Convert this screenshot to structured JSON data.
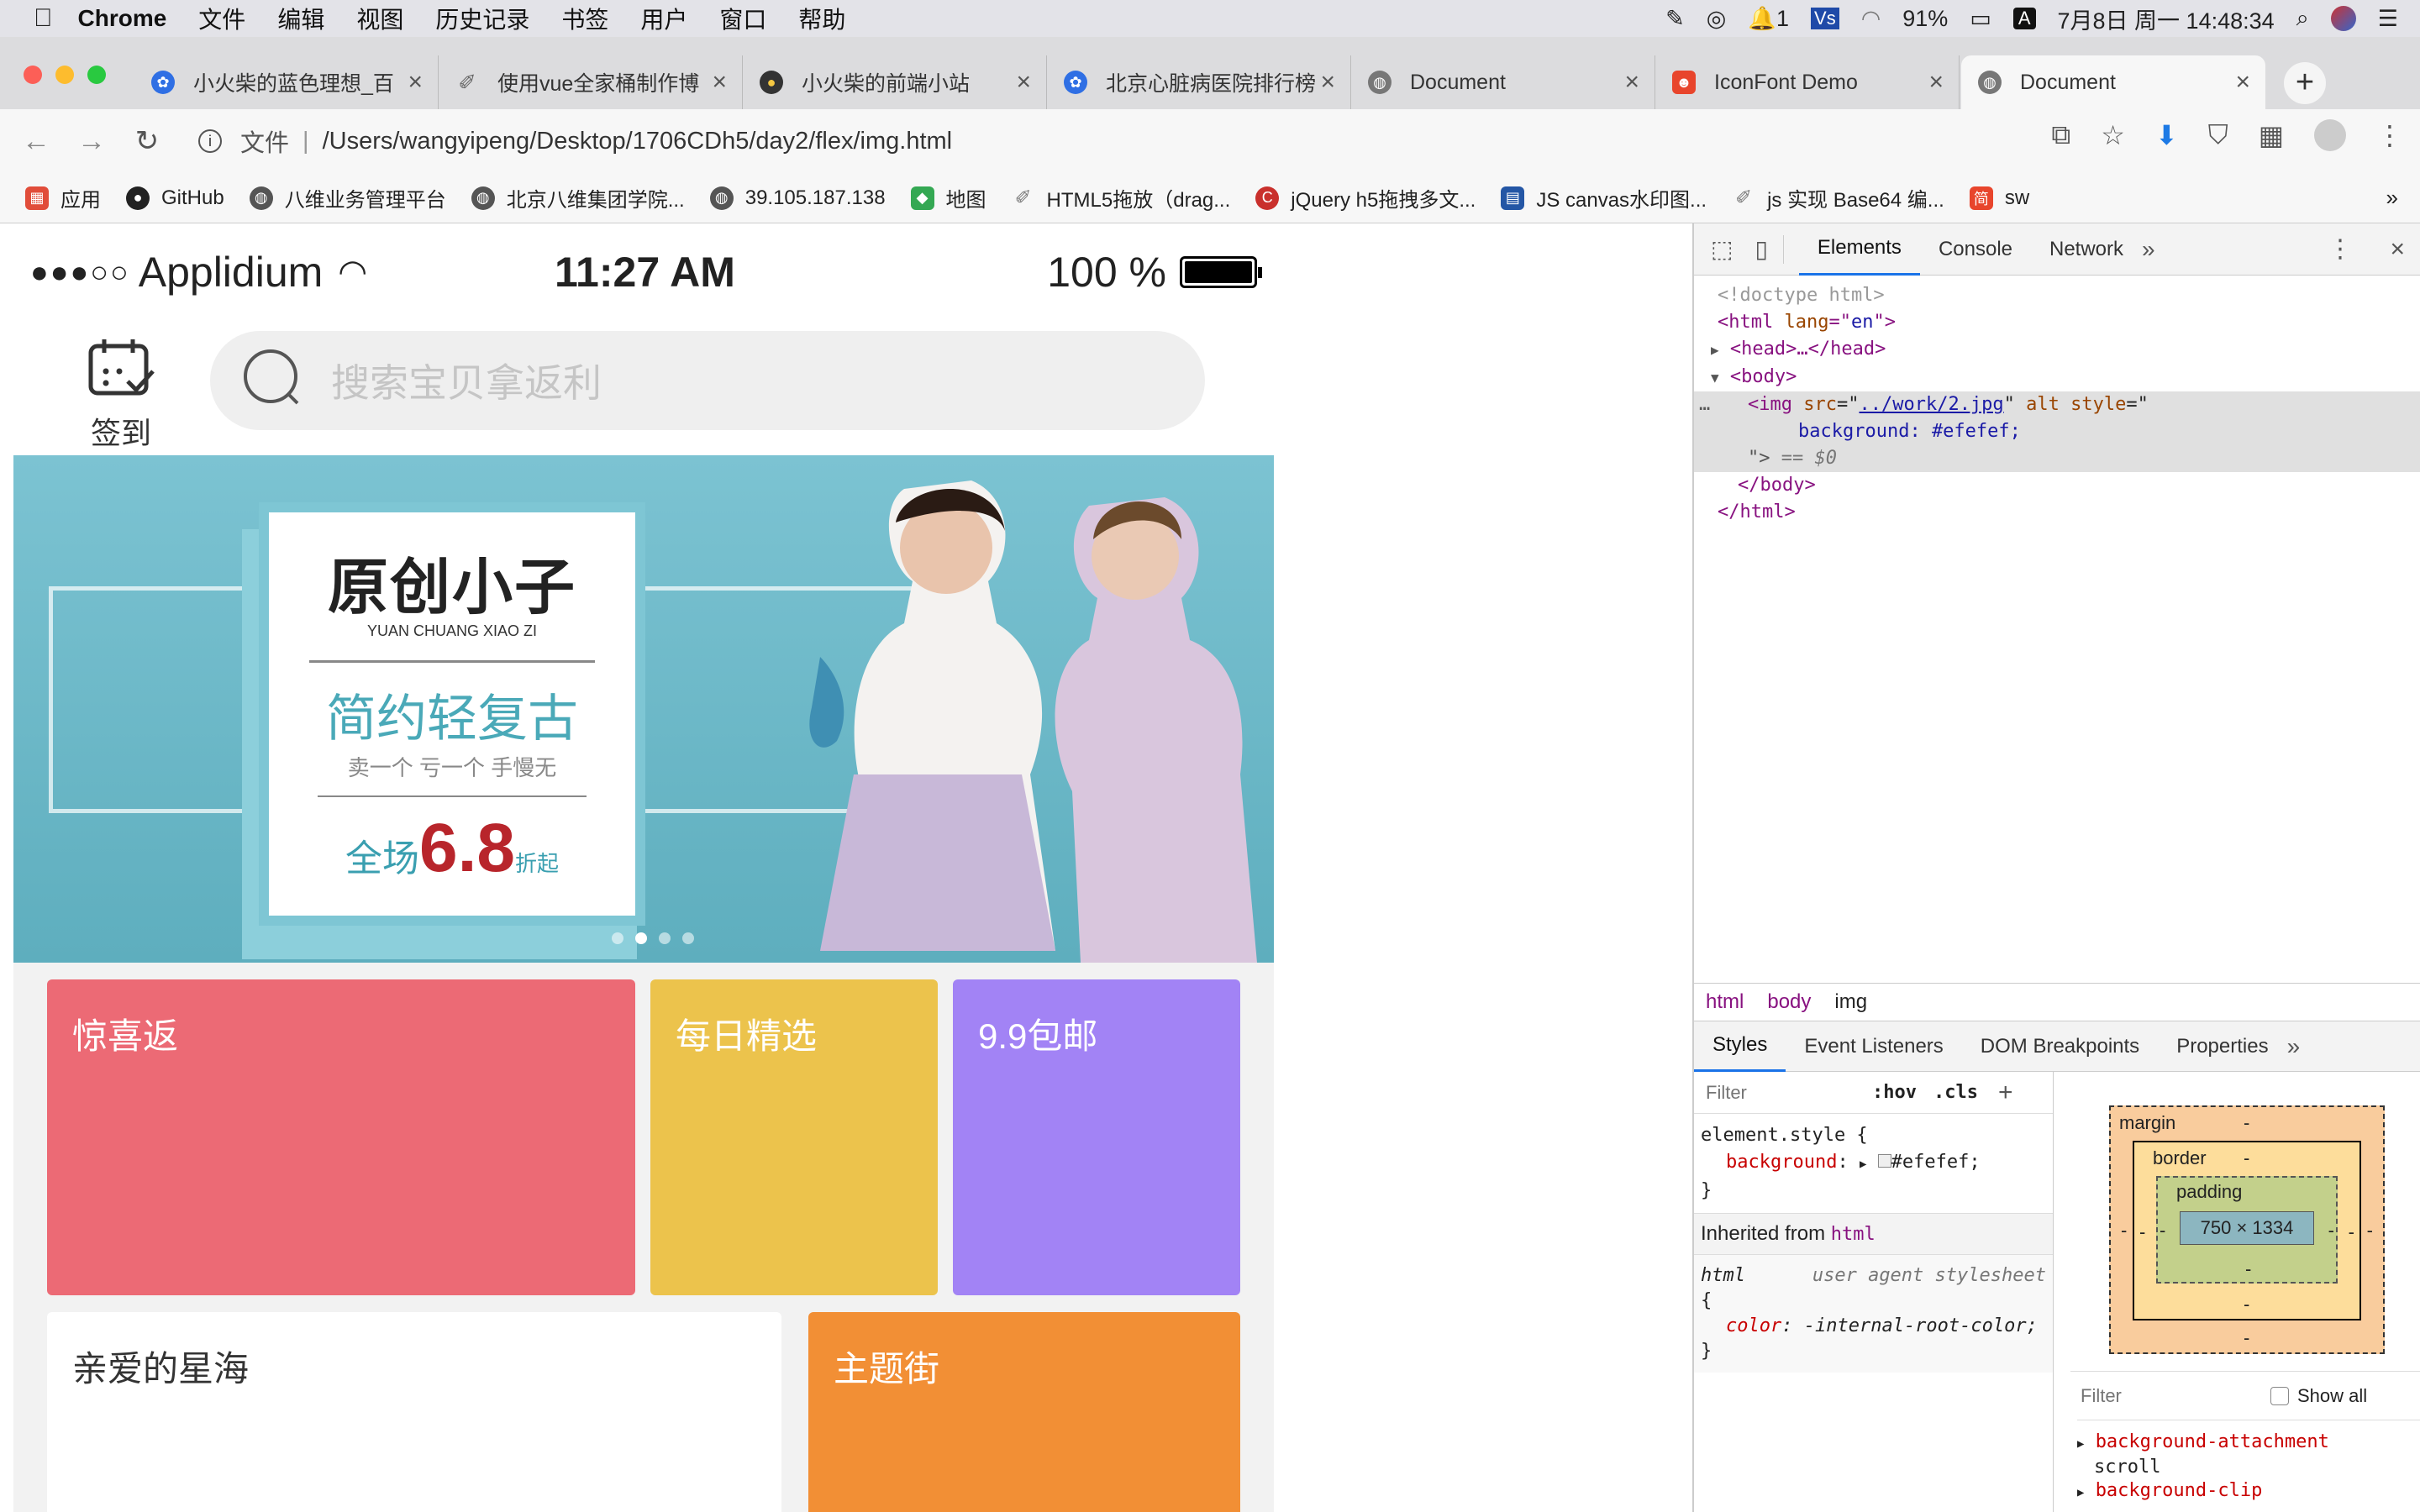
{
  "menubar": {
    "app": "Chrome",
    "items": [
      "文件",
      "编辑",
      "视图",
      "历史记录",
      "书签",
      "用户",
      "窗口",
      "帮助"
    ],
    "notif_count": "1",
    "battery": "91%",
    "input_method": "A",
    "datetime": "7月8日 周一 14:48:34"
  },
  "tabs": [
    {
      "label": "小火柴的蓝色理想_百",
      "icon": "baidu-icon",
      "color": "#2f6fe4"
    },
    {
      "label": "使用vue全家桶制作博",
      "icon": "feather-icon",
      "color": "#666"
    },
    {
      "label": "小火柴的前端小站",
      "icon": "site-icon",
      "color": "#333"
    },
    {
      "label": "北京心脏病医院排行榜",
      "icon": "baidu-icon",
      "color": "#2f6fe4"
    },
    {
      "label": "Document",
      "icon": "globe-icon",
      "color": "#666"
    },
    {
      "label": "IconFont Demo",
      "icon": "iconfont-icon",
      "color": "#e8452c"
    },
    {
      "label": "Document",
      "icon": "globe-icon",
      "color": "#666",
      "active": true
    }
  ],
  "toolbar": {
    "file_label": "文件",
    "url": "/Users/wangyipeng/Desktop/1706CDh5/day2/flex/img.html"
  },
  "bookmarks": [
    {
      "label": "应用",
      "color": "#e14d3a"
    },
    {
      "label": "GitHub",
      "color": "#222"
    },
    {
      "label": "八维业务管理平台",
      "color": "#555"
    },
    {
      "label": "北京八维集团学院...",
      "color": "#555"
    },
    {
      "label": "39.105.187.138",
      "color": "#555"
    },
    {
      "label": "地图",
      "color": "#34a853"
    },
    {
      "label": "HTML5拖放（drag...",
      "color": "#777"
    },
    {
      "label": "jQuery h5拖拽多文...",
      "color": "#c9302c"
    },
    {
      "label": "JS canvas水印图...",
      "color": "#2456a5"
    },
    {
      "label": "js 实现 Base64 编...",
      "color": "#777"
    },
    {
      "label": "sw",
      "color": "#e8452c"
    }
  ],
  "phone": {
    "carrier": "Applidium",
    "time": "11:27 AM",
    "battery": "100 %",
    "checkin_label": "签到",
    "search_placeholder": "搜索宝贝拿返利",
    "banner": {
      "brand_cn": "原创小子",
      "brand_en": "YUAN CHUANG XIAO ZI",
      "headline": "简约轻复古",
      "subline": "卖一个 亏一个 手慢无",
      "sale_prefix": "全场",
      "sale_value": "6.8",
      "sale_suffix": "折起"
    },
    "tiles": [
      {
        "label": "惊喜返",
        "color": "#ec6a75"
      },
      {
        "label": "每日精选",
        "color": "#ecc34c"
      },
      {
        "label": "9.9包邮",
        "color": "#a283f5"
      },
      {
        "label": "亲爱的星海",
        "color": "#ffffff"
      },
      {
        "label": "主题街",
        "color": "#f28f35"
      }
    ]
  },
  "devtools": {
    "tabs": [
      "Elements",
      "Console",
      "Network"
    ],
    "dom": {
      "doctype": "<!doctype html>",
      "html_open": "html",
      "lang_attr": "lang",
      "lang_val": "en",
      "head": "head",
      "body": "body",
      "img_src": "../work/2.jpg",
      "img_style": "background: #efefef;",
      "dollar": "== $0"
    },
    "breadcrumb": [
      "html",
      "body",
      "img"
    ],
    "style_tabs": [
      "Styles",
      "Event Listeners",
      "DOM Breakpoints",
      "Properties"
    ],
    "filter_placeholder": "Filter",
    "hov": ":hov",
    "cls": ".cls",
    "element_style": "element.style {",
    "bg_prop": "background",
    "bg_val": "#efefef",
    "inherited_label": "Inherited from",
    "inherited_from": "html",
    "ua_selector": "html",
    "ua_label": "user agent stylesheet",
    "ua_prop": "color",
    "ua_val": "-internal-root-color",
    "box": {
      "margin": "margin",
      "border": "border",
      "padding": "padding",
      "size": "750 × 1334",
      "dash": "-"
    },
    "computed_filter": "Filter",
    "show_all": "Show all",
    "computed": [
      {
        "prop": "background-attachment",
        "val": "scroll"
      },
      {
        "prop": "background-clip",
        "val": ""
      }
    ]
  }
}
